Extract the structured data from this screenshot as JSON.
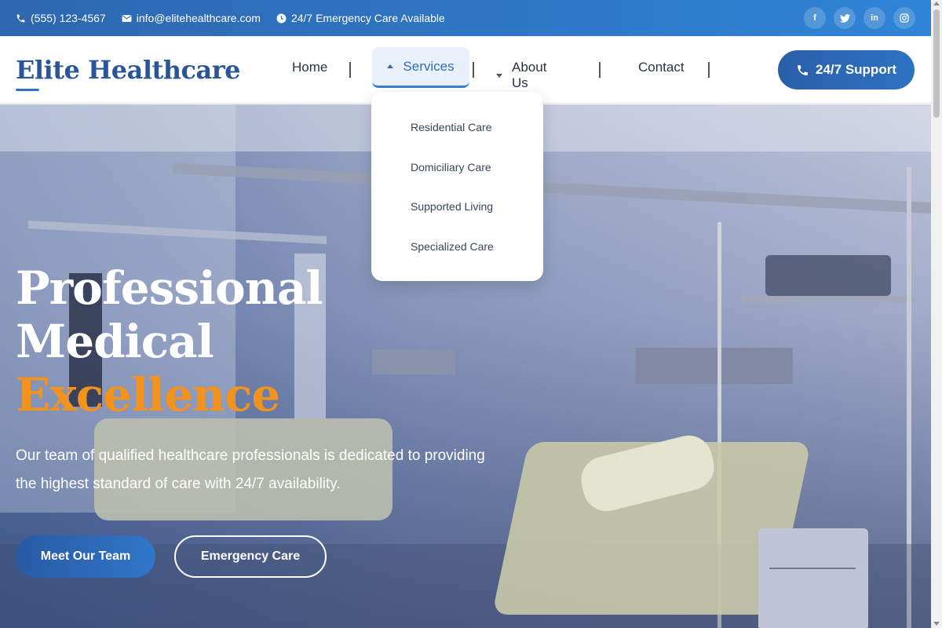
{
  "topbar": {
    "phone": "(555) 123-4567",
    "email": "info@elitehealthcare.com",
    "availability": "24/7 Emergency Care Available",
    "socials": [
      {
        "icon": "facebook-icon",
        "glyph": "f"
      },
      {
        "icon": "twitter-icon",
        "glyph": "t"
      },
      {
        "icon": "linkedin-icon",
        "glyph": "in"
      },
      {
        "icon": "instagram-icon",
        "glyph": "◎"
      }
    ]
  },
  "header": {
    "logo": "Elite Healthcare",
    "nav": {
      "home": "Home",
      "services": "Services",
      "about": "About Us",
      "contact": "Contact"
    },
    "support_button": "24/7 Support"
  },
  "dropdown": {
    "items": [
      "Residential Care",
      "Domiciliary Care",
      "Supported Living",
      "Specialized Care"
    ]
  },
  "hero": {
    "title_line1": "Professional",
    "title_line2": "Medical",
    "title_accent": "Excellence",
    "description": "Our team of qualified healthcare professionals is dedicated to providing the highest standard of care with 24/7 availability.",
    "primary_button": "Meet Our Team",
    "secondary_button": "Emergency Care"
  },
  "colors": {
    "brand": "#2a5596",
    "accent": "#f3921c",
    "topbar": "#2f7ac6"
  }
}
